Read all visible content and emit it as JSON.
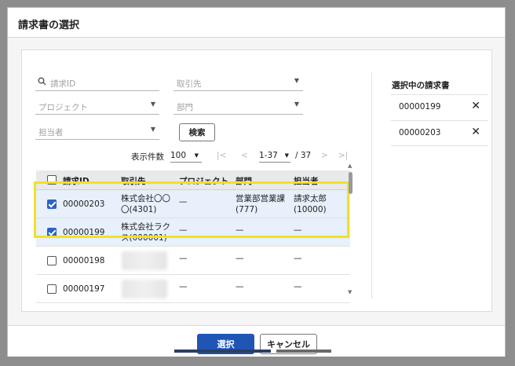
{
  "dialog": {
    "title": "請求書の選択",
    "primary_label": "選択",
    "secondary_label": "キャンセル"
  },
  "filters": {
    "invoice_id_placeholder": "請求ID",
    "client_placeholder": "取引先",
    "project_placeholder": "プロジェクト",
    "department_placeholder": "部門",
    "owner_placeholder": "担当者",
    "search_label": "検索"
  },
  "pager": {
    "page_size_label": "表示件数",
    "page_size": "100",
    "range": "1-37",
    "total": "/ 37"
  },
  "table": {
    "headers": [
      "請求ID",
      "取引先",
      "プロジェクト",
      "部門",
      "担当者"
    ],
    "rows": [
      {
        "checked": true,
        "id": "00000203",
        "client_1": "株式会社〇〇",
        "client_2": "〇(4301)",
        "project": "—",
        "dept_1": "営業部営業課",
        "dept_2": "(777)",
        "owner_1": "請求太郎",
        "owner_2": "(10000)"
      },
      {
        "checked": true,
        "id": "00000199",
        "client_1": "株式会社ラク",
        "client_2": "ス(000001)",
        "project": "—",
        "dept_1": "—",
        "dept_2": "",
        "owner_1": "—",
        "owner_2": ""
      },
      {
        "checked": false,
        "id": "00000198",
        "client_1": "",
        "client_2": "",
        "project": "—",
        "dept_1": "—",
        "dept_2": "",
        "owner_1": "—",
        "owner_2": ""
      },
      {
        "checked": false,
        "id": "00000197",
        "client_1": "",
        "client_2": "",
        "project": "—",
        "dept_1": "—",
        "dept_2": "",
        "owner_1": "—",
        "owner_2": ""
      }
    ]
  },
  "selected_panel": {
    "title": "選択中の請求書",
    "items": [
      "00000199",
      "00000203"
    ]
  },
  "colors": {
    "primary": "#1f55b5",
    "checkbox": "#2a63c4",
    "highlight": "#f2df2a",
    "selected_row": "#e7f0fb"
  }
}
